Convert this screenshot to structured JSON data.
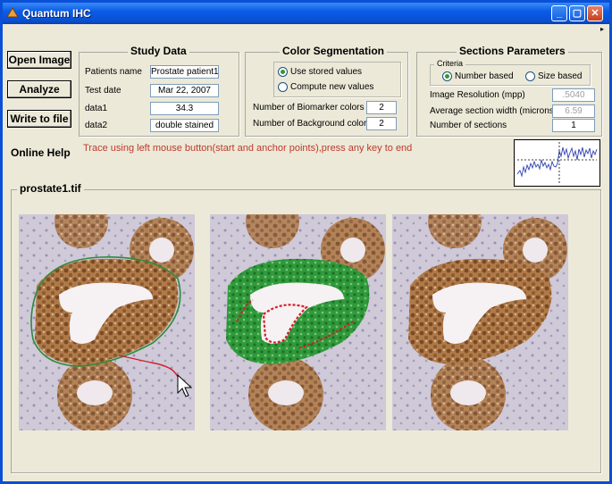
{
  "window": {
    "title": "Quantum IHC",
    "menu_arrow": "▸"
  },
  "buttons": {
    "open": "Open Image",
    "analyze": "Analyze",
    "write": "Write to file"
  },
  "study": {
    "title": "Study Data",
    "fields": [
      {
        "label": "Patients name",
        "value": "Prostate patient1"
      },
      {
        "label": "Test date",
        "value": "Mar 22, 2007"
      },
      {
        "label": "data1",
        "value": "34.3"
      },
      {
        "label": "data2",
        "value": "double stained"
      }
    ]
  },
  "color_seg": {
    "title": "Color Segmentation",
    "options": [
      "Use stored values",
      "Compute new values"
    ],
    "selected": 0,
    "biomarker_label": "Number of Biomarker colors",
    "biomarker_value": "2",
    "background_label": "Number of Background colors",
    "background_value": "2"
  },
  "sections": {
    "title": "Sections Parameters",
    "criteria_title": "Criteria",
    "criteria": [
      "Number based",
      "Size based"
    ],
    "selected": 0,
    "resolution_label": "Image Resolution (mpp)",
    "resolution_value": ".5040",
    "width_label": "Average section width (microns)",
    "width_value": "6.59",
    "count_label": "Number of sections",
    "count_value": "1"
  },
  "help": {
    "label": "Online Help",
    "instruction": "Trace using left mouse button(start and anchor points),press any key to end"
  },
  "image": {
    "filename": "prostate1.tif"
  },
  "colors": {
    "trace_text": "#c0392b",
    "outline_green": "#2e8b3a",
    "outline_red": "#d0202a",
    "titlebar": "#0a5ce8"
  },
  "icons": {
    "minimize": "minimize-icon",
    "maximize": "maximize-icon",
    "close": "close-icon",
    "cursor": "arrow-cursor-icon"
  }
}
